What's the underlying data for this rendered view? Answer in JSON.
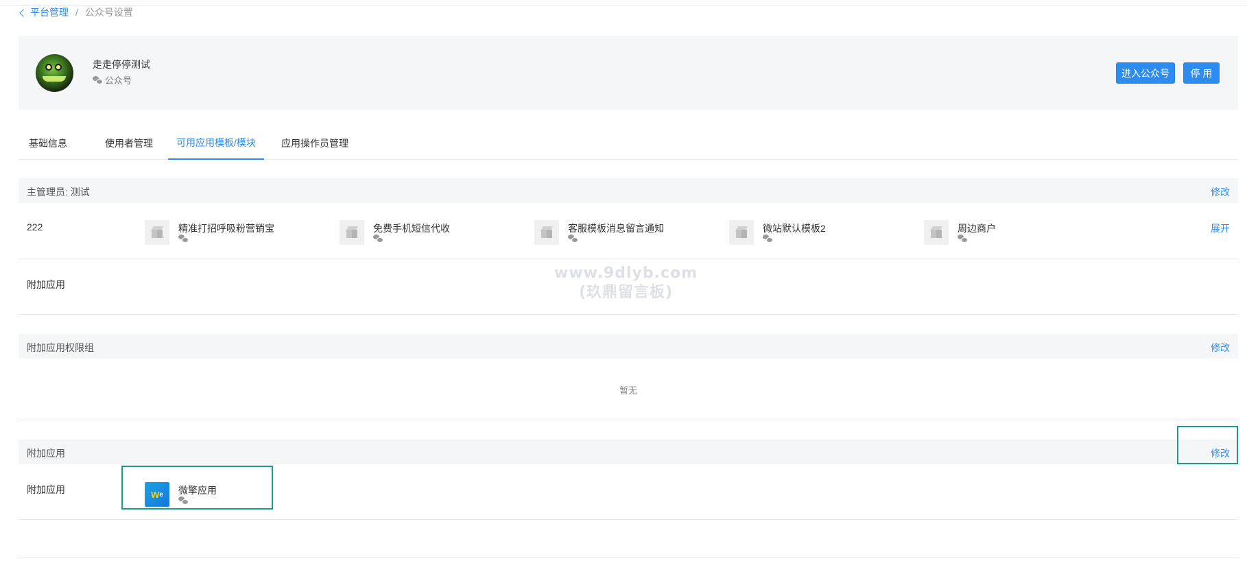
{
  "breadcrumb": {
    "back": "平台管理",
    "separator": "/",
    "current": "公众号设置"
  },
  "account": {
    "name": "走走停停测试",
    "type": "公众号"
  },
  "buttons": {
    "enter": "进入公众号",
    "disable": "停 用"
  },
  "tabs": [
    "基础信息",
    "使用者管理",
    "可用应用模板/模块",
    "应用操作员管理"
  ],
  "active_tab": "可用应用模板/模块",
  "section1": {
    "header": "主管理员: 测试",
    "action": "修改",
    "row1_label": "222",
    "apps": [
      "精准打招呼吸粉营销宝",
      "免费手机短信代收",
      "客服模板消息留言通知",
      "微站默认模板2",
      "周边商户"
    ],
    "expand": "展开",
    "row2_label": "附加应用"
  },
  "section2": {
    "header": "附加应用权限组",
    "action": "修改",
    "empty": "暂无"
  },
  "section3": {
    "header": "附加应用",
    "action": "修改",
    "row_label": "附加应用",
    "app_name": "微擎应用"
  },
  "watermark": {
    "line1": "www.9dlyb.com",
    "line2": "(玖鼎留言板)"
  }
}
